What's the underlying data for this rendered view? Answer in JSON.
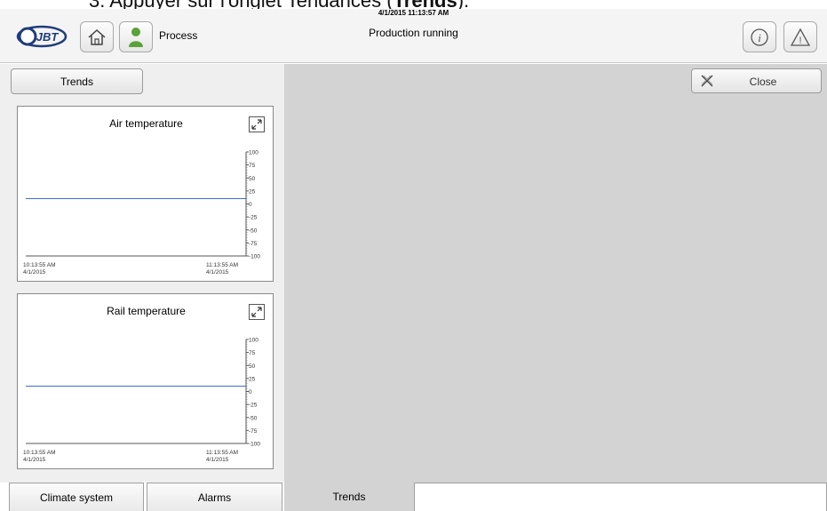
{
  "doc_fragment": {
    "prefix": "3.   Appuyer sur l'onglet Tendances (",
    "bold": "Trends",
    "suffix": ")."
  },
  "header": {
    "logo_text": "JBT",
    "process_label": "Process",
    "timestamp": "4/1/2015 11:13:57 AM",
    "status": "Production running",
    "icons": [
      "home-icon",
      "operator-icon",
      "info-icon",
      "warning-icon"
    ]
  },
  "section": {
    "title": "Trends",
    "close_label": "Close"
  },
  "trends": [
    {
      "title": "Air temperature",
      "ticks": [
        "100",
        "75",
        "50",
        "25",
        "0",
        "-25",
        "-50",
        "-75",
        "-100"
      ],
      "x_start_time": "10:13:55 AM",
      "x_start_date": "4/1/2015",
      "x_end_time": "11:13:55 AM",
      "x_end_date": "4/1/2015"
    },
    {
      "title": "Rail temperature",
      "ticks": [
        "100",
        "75",
        "50",
        "25",
        "0",
        "-25",
        "-50",
        "-75",
        "-100"
      ],
      "x_start_time": "10:13:55 AM",
      "x_start_date": "4/1/2015",
      "x_end_time": "11:13:55 AM",
      "x_end_date": "4/1/2015"
    }
  ],
  "tabs": [
    {
      "label": "Climate system",
      "active": false
    },
    {
      "label": "Alarms",
      "active": false
    },
    {
      "label": "Trends",
      "active": true
    }
  ],
  "colors": {
    "trend_line": "#3d6fd6",
    "background": "#d3d3d3"
  }
}
